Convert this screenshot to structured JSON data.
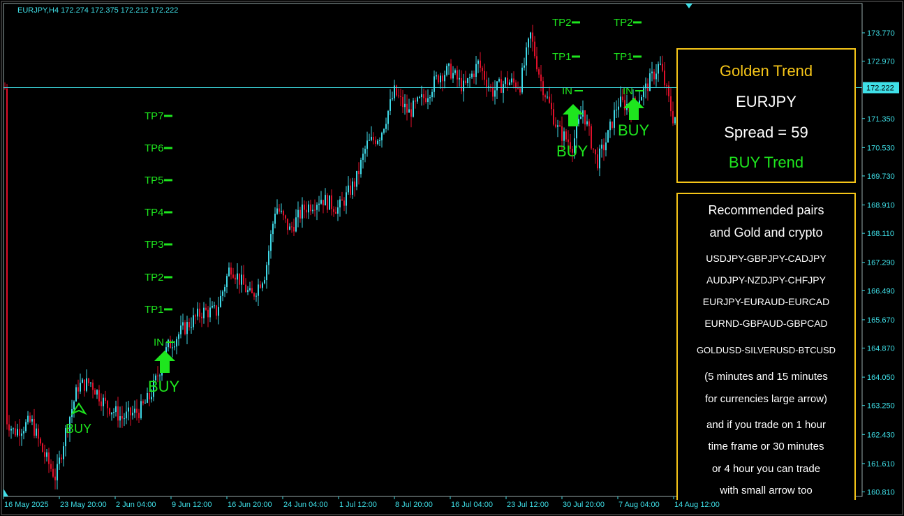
{
  "header": {
    "symbol_line": "EURJPY,H4  172.274 172.375 172.212 172.222"
  },
  "price_axis": {
    "labels": [
      "173.770",
      "172.970",
      "171.350",
      "170.530",
      "169.730",
      "168.910",
      "168.110",
      "167.290",
      "166.490",
      "165.670",
      "164.870",
      "164.050",
      "163.250",
      "162.430",
      "161.610",
      "160.810"
    ],
    "current_price": "172.222"
  },
  "time_axis": {
    "labels": [
      "16 May 2025",
      "23 May 20:00",
      "2 Jun 04:00",
      "9 Jun 12:00",
      "16 Jun 20:00",
      "24 Jun 04:00",
      "1 Jul 12:00",
      "8 Jul 20:00",
      "16 Jul 04:00",
      "23 Jul 12:00",
      "30 Jul 20:00",
      "7 Aug 04:00",
      "14 Aug 12:00"
    ]
  },
  "tp_labels": {
    "left": [
      "TP7",
      "TP6",
      "TP5",
      "TP4",
      "TP3",
      "TP2",
      "TP1"
    ],
    "right_a": [
      "TP2",
      "TP1"
    ],
    "right_b": [
      "TP2",
      "TP1"
    ],
    "entry": "IN"
  },
  "signals": {
    "buy": "BUY"
  },
  "trend_panel": {
    "title": "Golden Trend",
    "symbol": "EURJPY",
    "spread": "Spread = 59",
    "trend": "BUY Trend"
  },
  "pairs_panel": {
    "heading1": "Recommended pairs",
    "heading2": "and Gold and crypto",
    "pairs": [
      "USDJPY-GBPJPY-CADJPY",
      "AUDJPY-NZDJPY-CHFJPY",
      "EURJPY-EURAUD-EURCAD",
      "EURND-GBPAUD-GBPCAD",
      "GOLDUSD-SILVERUSD-BTCUSD"
    ],
    "notes": [
      "(5 minutes and 15 minutes",
      "for currencies large arrow)",
      "and if you trade on 1 hour",
      "time frame or 30 minutes",
      "or 4 hour you can trade",
      "with small arrow too"
    ]
  },
  "colors": {
    "bull": "#3fd8e6",
    "bear": "#e0102a",
    "accent": "#3fe0e8",
    "signal": "#1ee61e",
    "panel_border": "#f5c518"
  },
  "chart_data": {
    "type": "candlestick",
    "symbol": "EURJPY",
    "timeframe": "H4",
    "ylim": [
      160.6,
      174.5
    ],
    "current_price": 172.222,
    "close_path": [
      {
        "x": "16 May 2025",
        "y": 162.9
      },
      {
        "x": "23 May 20:00",
        "y": 163.6
      },
      {
        "x": "2 Jun 04:00",
        "y": 163.3
      },
      {
        "x": "9 Jun 12:00",
        "y": 165.2
      },
      {
        "x": "16 Jun 20:00",
        "y": 166.6
      },
      {
        "x": "24 Jun 04:00",
        "y": 168.9
      },
      {
        "x": "1 Jul 12:00",
        "y": 169.8
      },
      {
        "x": "8 Jul 20:00",
        "y": 171.8
      },
      {
        "x": "16 Jul 04:00",
        "y": 172.7
      },
      {
        "x": "23 Jul 12:00",
        "y": 172.6
      },
      {
        "x": "30 Jul 20:00",
        "y": 170.6
      },
      {
        "x": "7 Aug 04:00",
        "y": 172.3
      },
      {
        "x": "14 Aug 12:00",
        "y": 172.2
      }
    ]
  }
}
